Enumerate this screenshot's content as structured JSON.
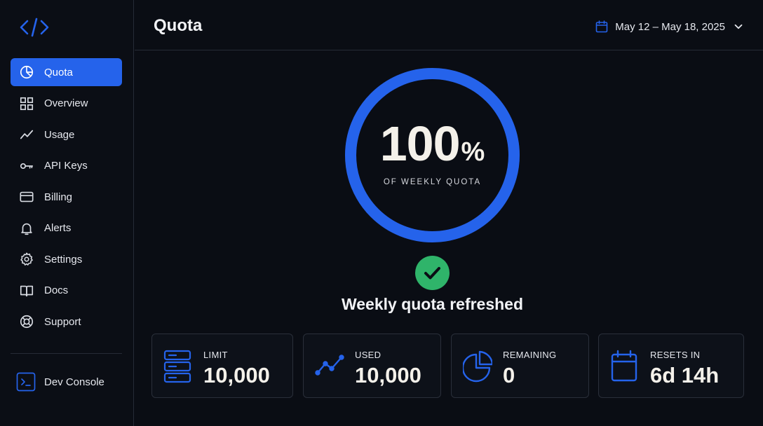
{
  "sidebar": {
    "logo_icon": "code-brackets-icon",
    "items": [
      {
        "label": "Quota",
        "icon": "pie-chart-icon",
        "active": true
      },
      {
        "label": "Overview",
        "icon": "grid-icon",
        "active": false
      },
      {
        "label": "Usage",
        "icon": "trend-line-icon",
        "active": false
      },
      {
        "label": "API Keys",
        "icon": "key-icon",
        "active": false
      },
      {
        "label": "Billing",
        "icon": "credit-card-icon",
        "active": false
      },
      {
        "label": "Alerts",
        "icon": "bell-icon",
        "active": false
      },
      {
        "label": "Settings",
        "icon": "gear-icon",
        "active": false
      },
      {
        "label": "Docs",
        "icon": "book-icon",
        "active": false
      },
      {
        "label": "Support",
        "icon": "lifebuoy-icon",
        "active": false
      }
    ],
    "footer": {
      "label": "Dev Console",
      "icon": "terminal-icon"
    }
  },
  "header": {
    "title": "Quota",
    "date_range": "May 12 – May 18, 2025"
  },
  "gauge": {
    "value": "100",
    "unit": "%",
    "fraction": 1.0,
    "caption": "OF WEEKLY QUOTA"
  },
  "status": {
    "icon": "check-circle-icon",
    "message": "Weekly quota refreshed"
  },
  "stats": [
    {
      "label": "LIMIT",
      "value": "10,000",
      "icon": "server-stack-icon"
    },
    {
      "label": "USED",
      "value": "10,000",
      "icon": "trend-line-icon"
    },
    {
      "label": "REMAINING",
      "value": "0",
      "icon": "pie-chart-icon"
    },
    {
      "label": "RESETS IN",
      "value": "6d 14h",
      "icon": "calendar-icon"
    }
  ],
  "colors": {
    "accent": "#2563eb",
    "success": "#2fb46a",
    "background": "#0a0d14",
    "text": "#f4f1ea"
  }
}
